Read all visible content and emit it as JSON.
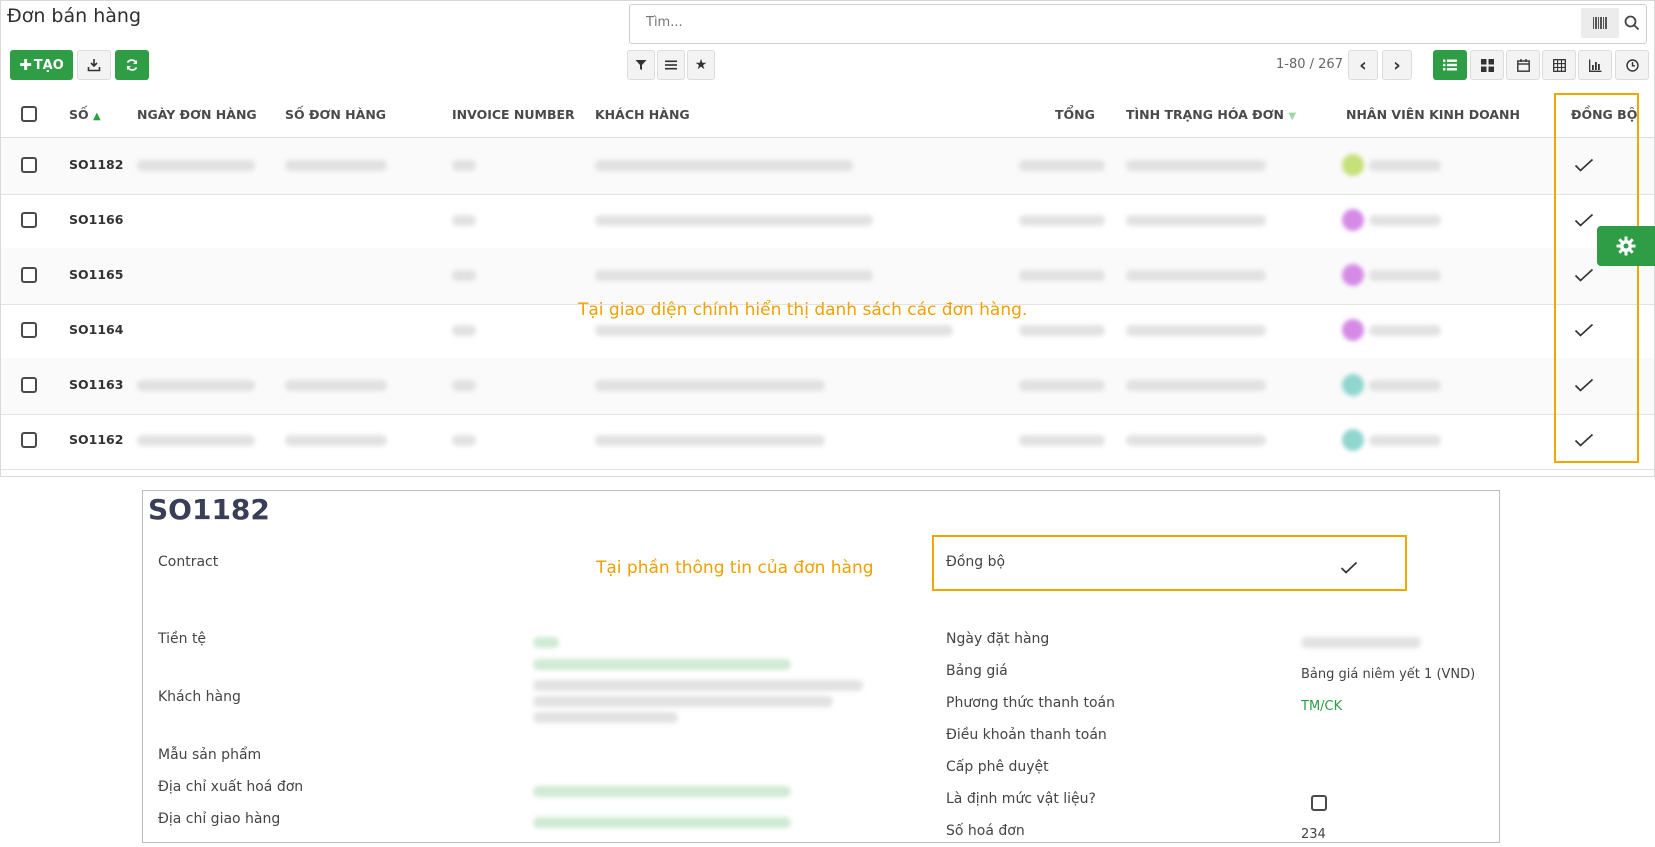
{
  "header": {
    "title": "Đơn bán hàng",
    "search_placeholder": "Tìm...",
    "create_label": "TẠO",
    "pager": "1-80 / 267"
  },
  "columns": {
    "so": "SỐ",
    "order_date": "NGÀY ĐƠN HÀNG",
    "order_number": "SỐ ĐƠN HÀNG",
    "invoice_number": "INVOICE NUMBER",
    "customer": "KHÁCH HÀNG",
    "total": "TỔNG",
    "invoice_status": "TÌNH TRẠNG HÓA ĐƠN",
    "salesperson": "NHÂN VIÊN KINH DOANH",
    "sync": "ĐỒNG BỘ"
  },
  "rows": [
    {
      "so": "SO1182",
      "synced": true,
      "avatar_color": "#c6e07a"
    },
    {
      "so": "SO1166",
      "synced": true,
      "avatar_color": "#d58be6"
    },
    {
      "so": "SO1165",
      "synced": true,
      "avatar_color": "#d58be6"
    },
    {
      "so": "SO1164",
      "synced": true,
      "avatar_color": "#d58be6"
    },
    {
      "so": "SO1163",
      "synced": true,
      "avatar_color": "#8fd6cf"
    },
    {
      "so": "SO1162",
      "synced": true,
      "avatar_color": "#8fd6cf"
    }
  ],
  "annotations": {
    "list_note": "Tại giao diện chính hiển thị danh sách các đơn hàng.",
    "form_note": "Tại phần thông tin của đơn hàng"
  },
  "form": {
    "title": "SO1182",
    "contract_label": "Contract",
    "sync_label": "Đồng bộ",
    "currency_label": "Tiền tệ",
    "customer_label": "Khách hàng",
    "product_template_label": "Mẫu sản phẩm",
    "invoice_address_label": "Địa chỉ xuất hoá đơn",
    "delivery_address_label": "Địa chỉ giao hàng",
    "order_date_label": "Ngày đặt hàng",
    "pricelist_label": "Bảng giá",
    "pricelist_value": "Bảng giá niêm yết 1 (VND)",
    "payment_method_label": "Phương thức thanh toán",
    "payment_method_value": "TM/CK",
    "payment_terms_label": "Điều khoản thanh toán",
    "approval_level_label": "Cấp phê duyệt",
    "material_norm_label": "Là định mức vật liệu?",
    "invoice_number_label": "Số hoá đơn",
    "invoice_number_value": "234"
  },
  "colors": {
    "primary": "#2e9d45",
    "highlight": "#f0a800"
  }
}
